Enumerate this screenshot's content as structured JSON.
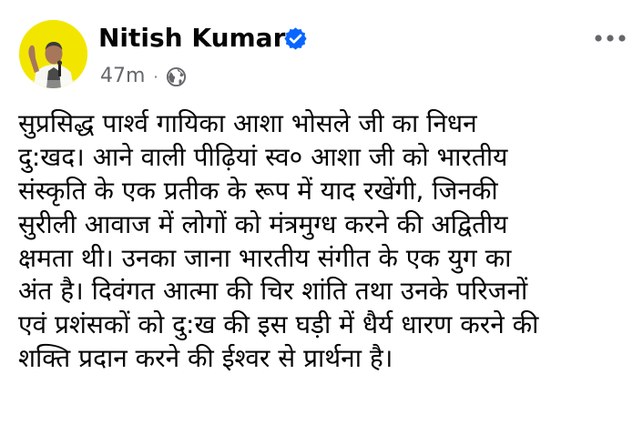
{
  "post": {
    "author": "Nitish Kumar",
    "verified": true,
    "time": "47m",
    "separator": "·",
    "audience_icon": "globe-icon",
    "more_icon": "more-options-icon",
    "text_lines": [
      "सुप्रसिद्ध पार्श्व गायिका आशा भोसले जी का निधन",
      "दु:खद। आने वाली पीढ़ियां स्व० आशा जी को भारतीय",
      "संस्कृति के एक प्रतीक के रूप में याद रखेंगी, जिनकी",
      "सुरीली आवाज में लोगों को मंत्रमुग्ध करने की अद्वितीय",
      "क्षमता थी। उनका जाना भारतीय संगीत के एक युग का",
      "अंत है। दिवंगत आत्मा की चिर शांति तथा उनके परिजनों",
      "एवं प्रशंसकों को दु:ख की इस घड़ी में धैर्य धारण करने की",
      "शक्ति प्रदान करने की ईश्वर से प्रार्थना है।"
    ]
  },
  "colors": {
    "verified_badge": "#0866ff",
    "avatar_background": "#f2e600",
    "meta_text": "#65676b",
    "body_text": "#050505"
  }
}
